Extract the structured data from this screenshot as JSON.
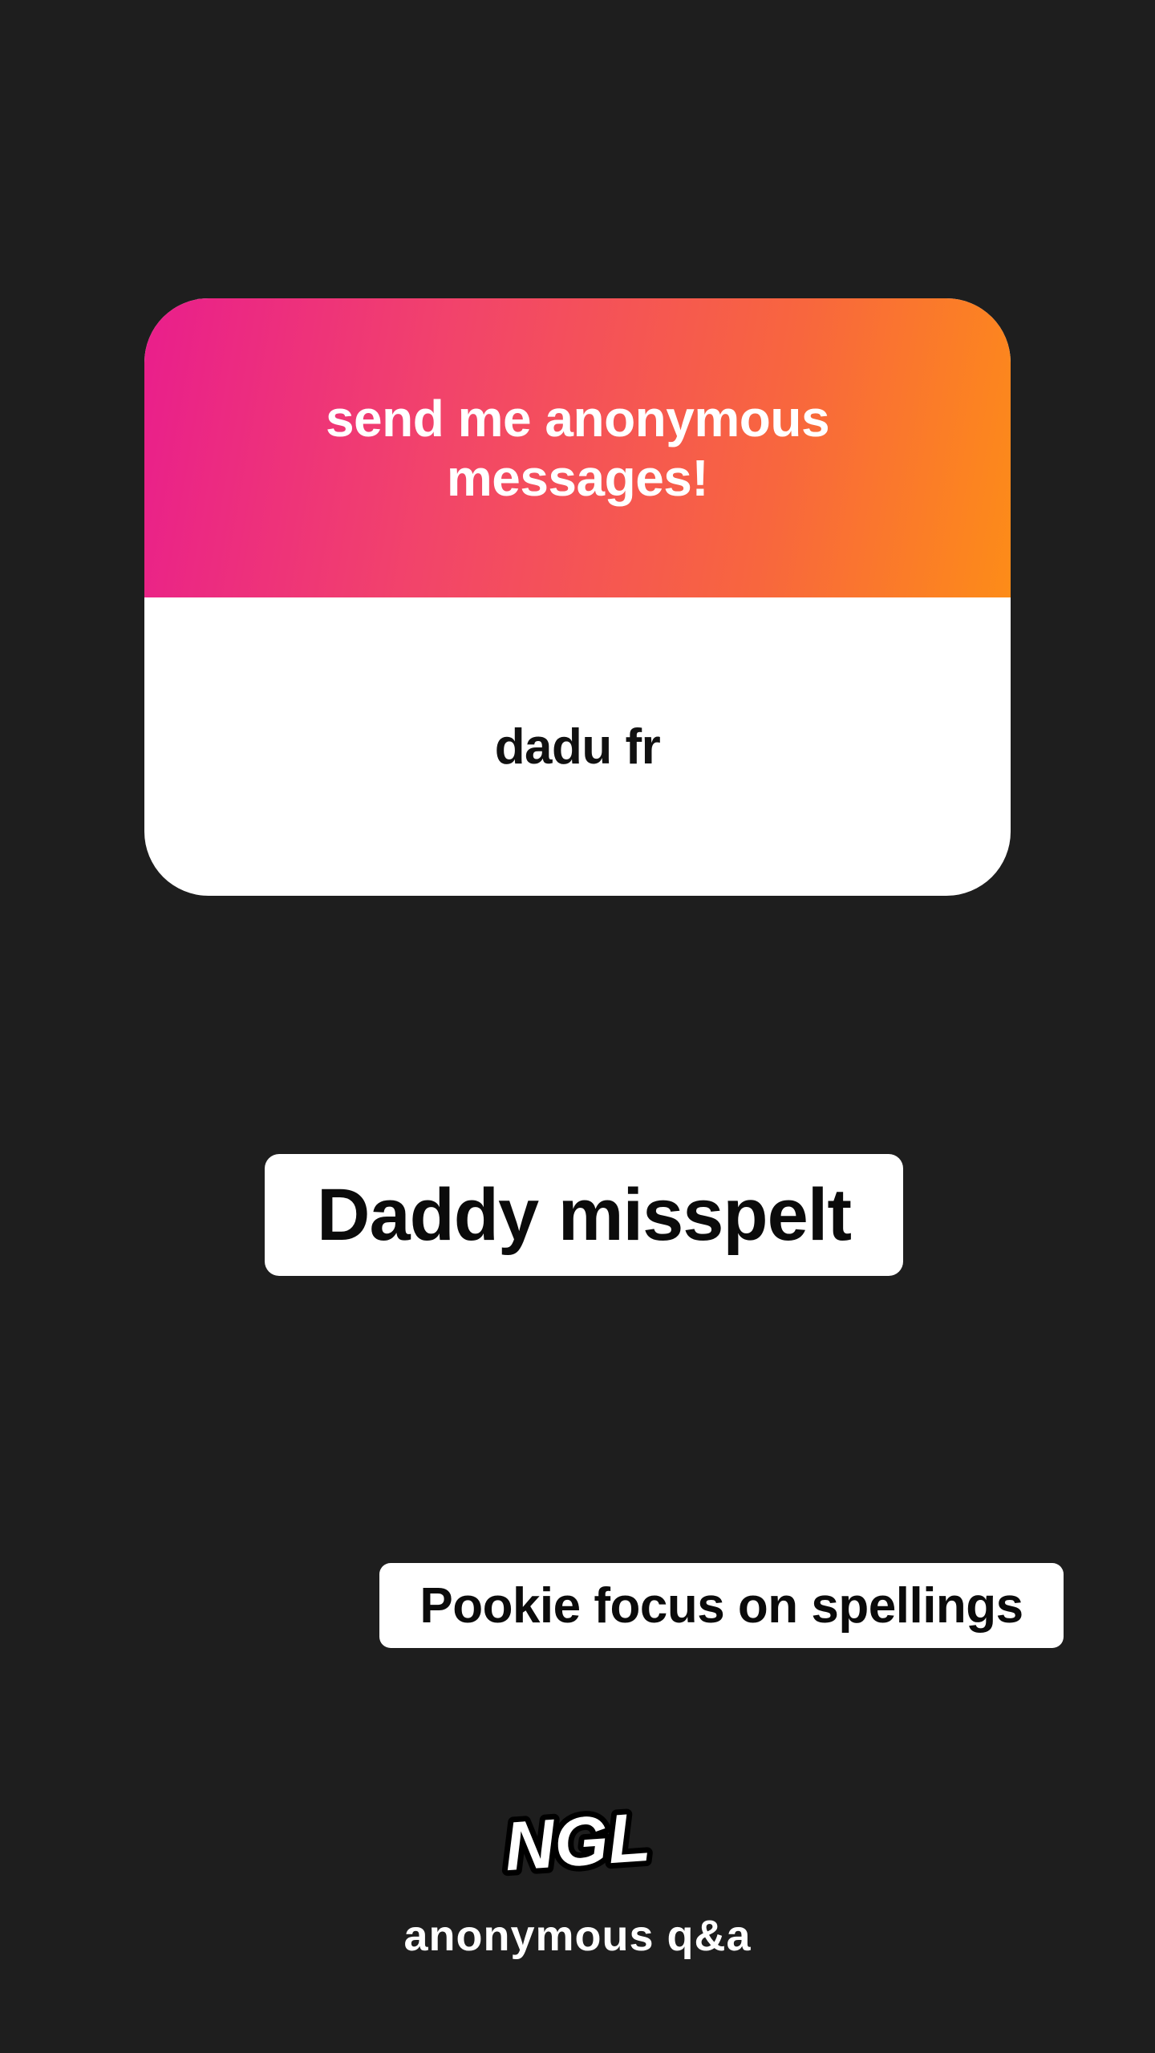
{
  "card": {
    "title": "send me anonymous messages!",
    "answer": "dadu fr",
    "gradient_colors": [
      "#e91e8c",
      "#fd8c18"
    ]
  },
  "stickers": [
    {
      "text": "Daddy misspelt"
    },
    {
      "text": "Pookie focus on spellings"
    }
  ],
  "branding": {
    "logo_text": "NGL",
    "tagline": "anonymous q&a"
  },
  "colors": {
    "background": "#1e1e1e",
    "card_body": "#ffffff",
    "sticker_bg": "#ffffff",
    "text_dark": "#0b0b0b"
  }
}
